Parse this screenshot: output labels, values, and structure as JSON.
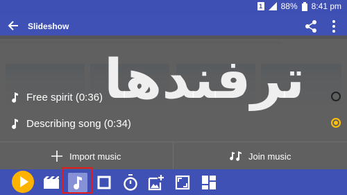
{
  "status_bar": {
    "battery": "88%",
    "time": "8:41 pm"
  },
  "app_bar": {
    "title": "Slideshow"
  },
  "songs": [
    {
      "label": "Free spirit  (0:36)",
      "selected": false
    },
    {
      "label": "Describing song  (0:34)",
      "selected": true
    }
  ],
  "actions": {
    "import_label": "Import music",
    "join_label": "Join music"
  },
  "watermark": "ترفندها",
  "colors": {
    "primary": "#3f51b5",
    "accent": "#ffc107",
    "highlight": "#e41b1b"
  },
  "toolbar": {
    "icons": [
      "play-icon",
      "movie-icon",
      "music-note-icon",
      "crop-icon",
      "timer-icon",
      "add-photo-icon",
      "aspect-ratio-icon",
      "layout-icon"
    ],
    "active": "music-note-icon"
  }
}
